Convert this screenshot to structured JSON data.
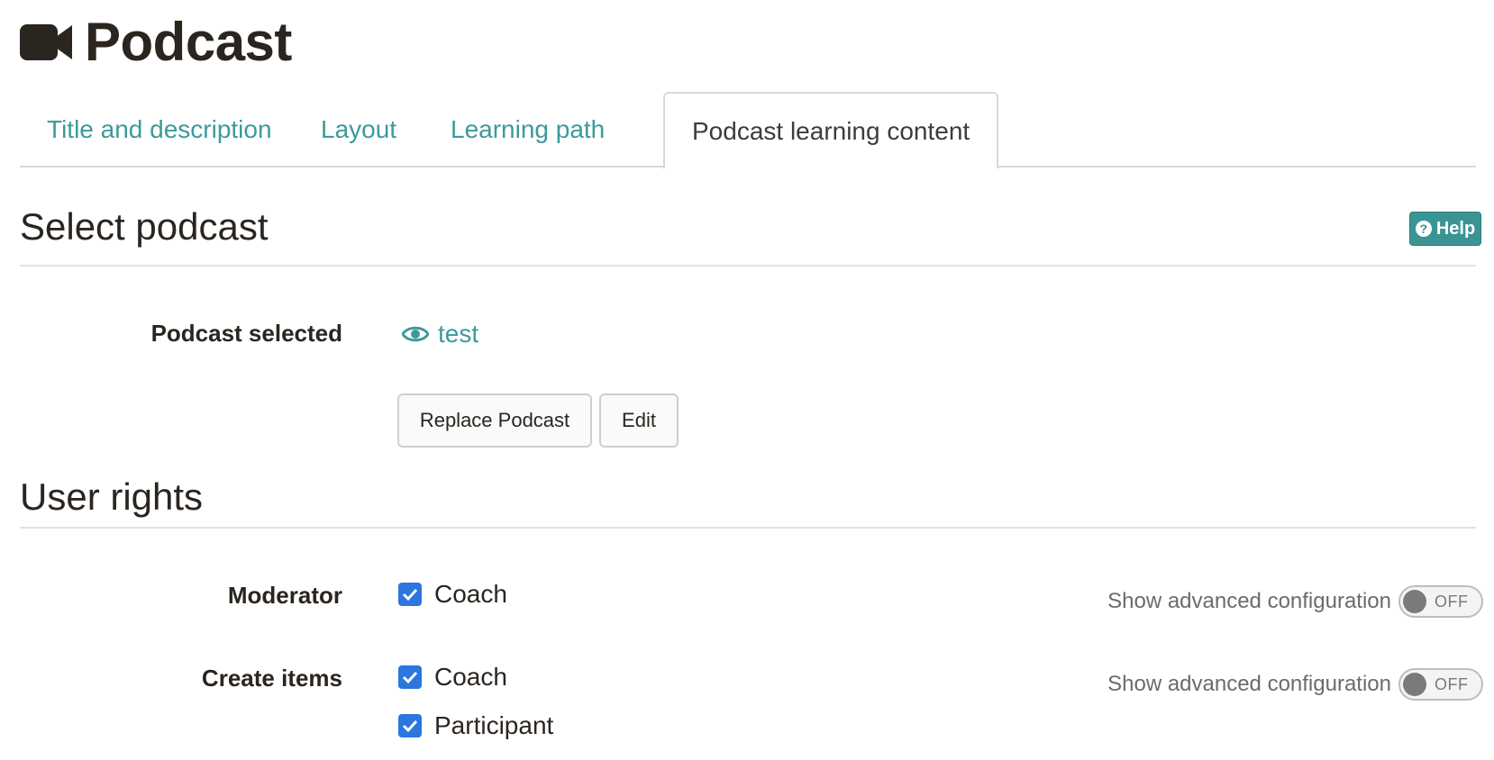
{
  "header": {
    "title": "Podcast",
    "icon": "video-camera-icon"
  },
  "tabs": [
    {
      "label": "Title and description",
      "active": false
    },
    {
      "label": "Layout",
      "active": false
    },
    {
      "label": "Learning path",
      "active": false
    },
    {
      "label": "Podcast learning content",
      "active": true
    }
  ],
  "select_section": {
    "title": "Select podcast",
    "help_label": "Help",
    "podcast_selected_label": "Podcast selected",
    "podcast_name": "test",
    "replace_button": "Replace Podcast",
    "edit_button": "Edit"
  },
  "rights_section": {
    "title": "User rights",
    "moderator": {
      "label": "Moderator",
      "options": [
        {
          "label": "Coach",
          "checked": true
        }
      ],
      "advanced_label": "Show advanced configuration",
      "toggle_state": "OFF"
    },
    "create_items": {
      "label": "Create items",
      "options": [
        {
          "label": "Coach",
          "checked": true
        },
        {
          "label": "Participant",
          "checked": true
        }
      ],
      "advanced_label": "Show advanced configuration",
      "toggle_state": "OFF"
    }
  },
  "colors": {
    "accent": "#3d9a9a",
    "help_button": "#3a9494",
    "checkbox": "#2c76e0",
    "text": "#2b2520"
  }
}
